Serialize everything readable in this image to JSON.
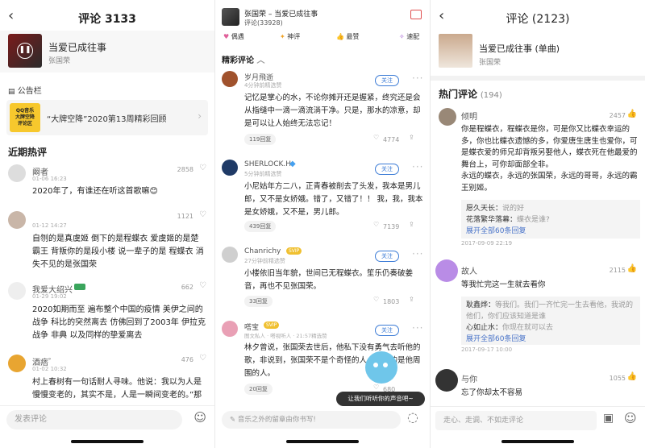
{
  "p1": {
    "title": "评论 3133",
    "song": {
      "name": "当爱已成往事",
      "artist": "张国荣"
    },
    "notice": {
      "label": "公告栏",
      "badge": "QQ音乐\n大牌空降\n评论区",
      "text": "“大牌空降”2020第13周精彩回顾"
    },
    "section": "近期热评",
    "comments": [
      {
        "user": "阚者",
        "time": "01-06 16:23",
        "likes": "2858",
        "text": "2020年了，有谁还在听这首歌嘛😊"
      },
      {
        "user": "",
        "time": "01-12 14:27",
        "likes": "1121",
        "text": "自刎的是真虞姬 倒下的是程蝶衣 爱虞姬的是楚霸王 背叛你的是段小楼 说一辈子的是 程蝶衣 消失不见的是张国荣"
      },
      {
        "user": "我爱大绍兴",
        "time": "01-29 19:02",
        "likes": "662",
        "text": "2020如期而至 遍布整个中国的疫情 美伊之间的战争 科比的突然离去 仿佛回到了2003年 伊拉克战争 非典 以及同样的挚爱离去"
      },
      {
        "user": "酒痞゛",
        "time": "01-02 10:32",
        "likes": "476",
        "text": "村上春树有一句话耐人寻味。他说：我以为人是慢慢变老的，其实不是，人是一瞬间变老的。”那个"
      }
    ],
    "input_placeholder": "发表评论"
  },
  "p2": {
    "header_title": "张国荣 – 当爱已成往事",
    "header_sub": "评论(33928)",
    "tabs": [
      "偶遇",
      "神评",
      "最赞",
      "速配"
    ],
    "section": "精彩评论",
    "follow_label": "关注",
    "comments": [
      {
        "user": "岁月飛逝",
        "time": "4分钟前精选赞",
        "text": "记忆是掌心的水，不论你摊开还是握紧，终究还是会从指缝中一滴一滴流淌干净。只是，那水的凉意，却是可以让人始终无法忘记！",
        "replies": "119回复",
        "likes": "4774"
      },
      {
        "user": "SHERLOCK.H",
        "time": "5分钟前精选赞",
        "text": "小尼姑年方二八，正青春被削去了头发，我本是男儿郎，又不是女娇娥。错了，又错了！！ 我，我，我本是女娇娥，又不是，男儿郎。",
        "replies": "439回复",
        "likes": "7139"
      },
      {
        "user": "Chanrichy",
        "time": "27分钟前精选赞",
        "text": "小楼依旧当年貌，世间已无程蝶衣。笙乐仍奏破姜音，再也不见张国荣。",
        "replies": "33回复",
        "likes": "1803"
      },
      {
        "user": "嗒宝",
        "time": "图文私人 · 嗒视听人 · 21:57精选赞",
        "text": "林夕曾说，张国荣去世后，他私下没有勇气去听他的歌，非说到，张国荣不是个奇怪的人，奇怪的是他周围的人。",
        "replies": "20回复",
        "likes": "680"
      }
    ],
    "bubble": "让我们听听你的声音吧~",
    "input_placeholder": "音乐之外的留章由你书写!"
  },
  "p3": {
    "title": "评论 (2123)",
    "song": {
      "name": "当爱已成往事 (单曲)",
      "artist": "张国荣"
    },
    "section": "热门评论",
    "section_count": "(194)",
    "comments": [
      {
        "user": "倾明",
        "likes": "2457",
        "text": "你是程蝶衣，程蝶衣是你，可是你又比蝶衣幸运的多，你也比蝶衣遗憾的多，你爱唐生唐生也爱你，可是蝶衣爱的师兄却背叛另娶他人，蝶衣死在他最爱的舞台上，可你却面部全非。\n永远的蝶衣，永远的张国荣，永远的哥哥，永远的霸王别姬。",
        "sub": [
          {
            "who": "愿久天长",
            "txt": "说的好"
          },
          {
            "who": "花落繁华落幕",
            "txt": "蝶衣是谁?"
          }
        ],
        "more": "展开全部60条回复",
        "date": "2017-09-09 22:19"
      },
      {
        "user": "故人",
        "likes": "2115",
        "text": "等我忙完这一生就去看你",
        "sub": [
          {
            "who": "耿鑫烨",
            "txt": "等我们。我们一齐忙完一生去看他，我说的他们，你们应该知道是谁"
          },
          {
            "who": "心如止水",
            "txt": "你现在就可以去"
          }
        ],
        "more": "展开全部60条回复",
        "date": "2017-09-17 10:00"
      },
      {
        "user": "与你",
        "likes": "1055",
        "text": "忘了你却太不容易"
      }
    ],
    "input_placeholder": "走心、走调、不如走评论"
  }
}
